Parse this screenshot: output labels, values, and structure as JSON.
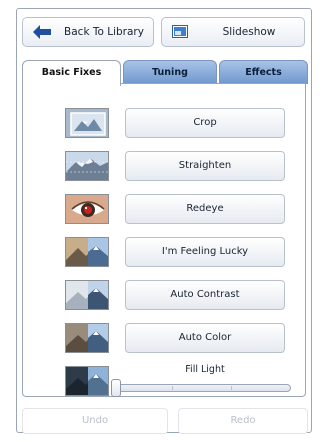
{
  "toolbar": {
    "back_label": "Back To Library",
    "back_icon": "arrow-left-icon",
    "slideshow_label": "Slideshow",
    "slideshow_icon": "slideshow-icon"
  },
  "tabs": [
    {
      "label": "Basic Fixes",
      "active": true
    },
    {
      "label": "Tuning",
      "active": false
    },
    {
      "label": "Effects",
      "active": false
    }
  ],
  "tools": [
    {
      "label": "Crop",
      "thumb": "crop-thumbnail"
    },
    {
      "label": "Straighten",
      "thumb": "straighten-thumbnail"
    },
    {
      "label": "Redeye",
      "thumb": "redeye-thumbnail"
    },
    {
      "label": "I'm Feeling Lucky",
      "thumb": "feeling-lucky-thumbnail"
    },
    {
      "label": "Auto Contrast",
      "thumb": "auto-contrast-thumbnail"
    },
    {
      "label": "Auto Color",
      "thumb": "auto-color-thumbnail"
    }
  ],
  "fill_light": {
    "label": "Fill Light",
    "value": 0
  },
  "history": {
    "undo_label": "Undo",
    "redo_label": "Redo"
  },
  "colors": {
    "tab_gradient_top": "#a9c3e6",
    "tab_gradient_bottom": "#6f97cf",
    "border": "#9aa6b6",
    "disabled_text": "#b9c0c8",
    "back_arrow": "#1f4e9c"
  }
}
